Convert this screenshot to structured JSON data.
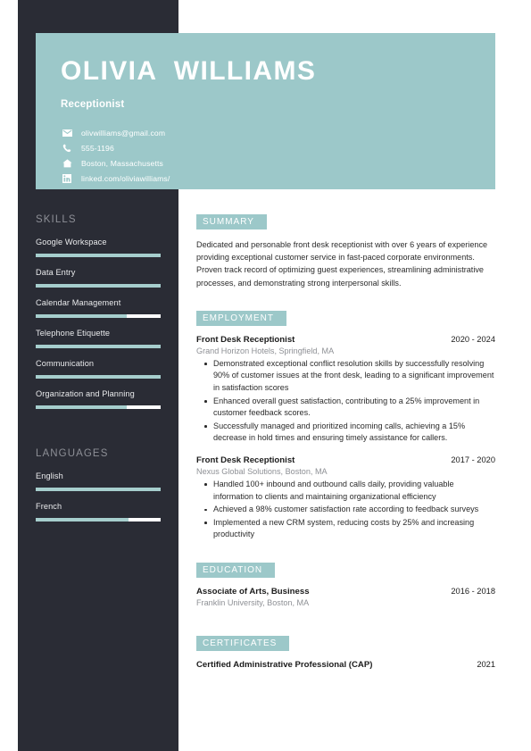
{
  "theme": {
    "sidebar_bg": "#2a2c35",
    "accent": "#9cc8c9",
    "bar_fill": "#a6cecd",
    "bar_track": "#ffffff",
    "heading_gray": "#8d8f96",
    "body_text": "#2b2b2b",
    "subtitle_gray": "#8e9095"
  },
  "header": {
    "name": "OLIVIA  WILLIAMS",
    "job_title": "Receptionist",
    "contacts": [
      {
        "icon": "envelope-icon",
        "text": "olivwilliams@gmail.com"
      },
      {
        "icon": "phone-icon",
        "text": "555-1196"
      },
      {
        "icon": "home-icon",
        "text": "Boston, Massachusetts"
      },
      {
        "icon": "linkedin-icon",
        "text": "linked.com/oliviawilliams/"
      }
    ]
  },
  "sidebar": {
    "skills": {
      "heading": "SKILLS",
      "items": [
        {
          "label": "Google Workspace",
          "level": 100
        },
        {
          "label": "Data Entry",
          "level": 100
        },
        {
          "label": "Calendar Management",
          "level": 73
        },
        {
          "label": "Telephone  Etiquette",
          "level": 100
        },
        {
          "label": "Communication",
          "level": 100
        },
        {
          "label": "Organization and Planning",
          "level": 73
        }
      ]
    },
    "languages": {
      "heading": "LANGUAGES",
      "items": [
        {
          "label": "English",
          "level": 100
        },
        {
          "label": "French",
          "level": 74
        }
      ]
    }
  },
  "main": {
    "summary": {
      "badge": "SUMMARY",
      "text": "Dedicated and personable front desk receptionist with over 6 years of experience providing exceptional customer service in fast-paced corporate environments. Proven track record of optimizing guest experiences, streamlining administrative processes, and demonstrating strong interpersonal skills."
    },
    "employment": {
      "badge": "EMPLOYMENT",
      "entries": [
        {
          "title": "Front Desk Receptionist",
          "date": "2020 - 2024",
          "subtitle": "Grand Horizon Hotels, Springfield, MA",
          "bullets": [
            "Demonstrated exceptional conflict resolution skills by successfully resolving 90% of customer issues at the front desk, leading to a significant improvement in satisfaction scores",
            "Enhanced overall guest satisfaction, contributing to a 25% improvement in customer feedback scores.",
            "Successfully managed and prioritized incoming calls, achieving a 15% decrease in hold times and ensuring timely assistance for callers."
          ]
        },
        {
          "title": "Front Desk Receptionist",
          "date": "2017 - 2020",
          "subtitle": "Nexus Global Solutions, Boston, MA",
          "bullets": [
            "Handled 100+ inbound and outbound calls daily, providing valuable information to clients and maintaining organizational efficiency",
            "Achieved a 98% customer satisfaction rate according to feedback surveys",
            "Implemented a new CRM system, reducing costs by 25% and increasing productivity"
          ]
        }
      ]
    },
    "education": {
      "badge": "EDUCATION",
      "entries": [
        {
          "title": "Associate of Arts, Business",
          "date": "2016 - 2018",
          "subtitle": "Franklin University, Boston, MA"
        }
      ]
    },
    "certificates": {
      "badge": "CERTIFICATES",
      "entries": [
        {
          "title": "Certified Administrative Professional (CAP)",
          "date": "2021"
        }
      ]
    }
  }
}
